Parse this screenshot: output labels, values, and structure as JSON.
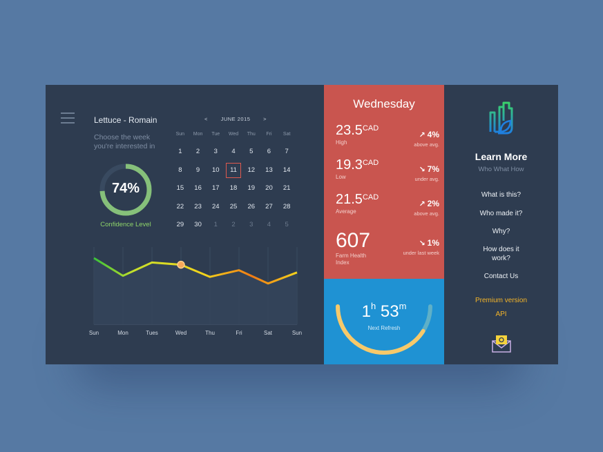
{
  "colors": {
    "background": "#5679a3",
    "card": "#2e3c50",
    "stats_panel": "#c9554f",
    "refresh_panel": "#1f92d3",
    "accent_green": "#8ed46a",
    "accent_orange": "#f5b528"
  },
  "left": {
    "menu_icon": "hamburger-icon",
    "crop_title": "Lettuce - Romain",
    "hint": "Choose the week you're interested in",
    "confidence": {
      "value": "74%",
      "fraction": 0.74,
      "label": "Confidence Level"
    }
  },
  "calendar": {
    "prev": "<",
    "month": "JUNE 2015",
    "next": ">",
    "weekdays": [
      "Sun",
      "Mon",
      "Tue",
      "Wed",
      "Thu",
      "Fri",
      "Sat"
    ],
    "rows": [
      [
        "1",
        "2",
        "3",
        "4",
        "5",
        "6",
        "7"
      ],
      [
        "8",
        "9",
        "10",
        "11",
        "12",
        "13",
        "14"
      ],
      [
        "15",
        "16",
        "17",
        "18",
        "19",
        "20",
        "21"
      ],
      [
        "22",
        "23",
        "24",
        "25",
        "26",
        "27",
        "28"
      ],
      [
        "29",
        "30",
        "1",
        "2",
        "3",
        "4",
        "5"
      ]
    ],
    "selected": "11"
  },
  "chart_data": {
    "type": "line",
    "categories": [
      "Sun",
      "Mon",
      "Tues",
      "Wed",
      "Thu",
      "Fri",
      "Sat",
      "Sun"
    ],
    "values": [
      6.0,
      4.4,
      5.6,
      5.4,
      4.3,
      4.9,
      3.7,
      4.7
    ],
    "highlight_index": 3,
    "ylim": [
      0,
      7
    ],
    "grid": true
  },
  "stats": {
    "day": "Wednesday",
    "items": [
      {
        "value": "23.5",
        "unit": "CAD",
        "label": "High",
        "direction": "up",
        "change": "4%",
        "note": "above avg."
      },
      {
        "value": "19.3",
        "unit": "CAD",
        "label": "Low",
        "direction": "down",
        "change": "7%",
        "note": "under avg."
      },
      {
        "value": "21.5",
        "unit": "CAD",
        "label": "Average",
        "direction": "up",
        "change": "2%",
        "note": "above avg."
      },
      {
        "value": "607",
        "unit": "",
        "label": "Farm Health Index",
        "direction": "down",
        "change": "1%",
        "note": "under last week"
      }
    ]
  },
  "refresh": {
    "hours": "1",
    "hours_unit": "h",
    "minutes": "53",
    "minutes_unit": "m",
    "label": "Next Refresh",
    "progress": 0.82
  },
  "learn_more": {
    "logo_icon": "city-leaf-logo-icon",
    "title": "Learn More",
    "subtitle": "Who What How",
    "links": [
      "What is this?",
      "Who made it?",
      "Why?",
      "How does it work?",
      "Contact Us"
    ],
    "premium": "Premium version",
    "api": "API",
    "mail_icon": "mail-icon"
  }
}
